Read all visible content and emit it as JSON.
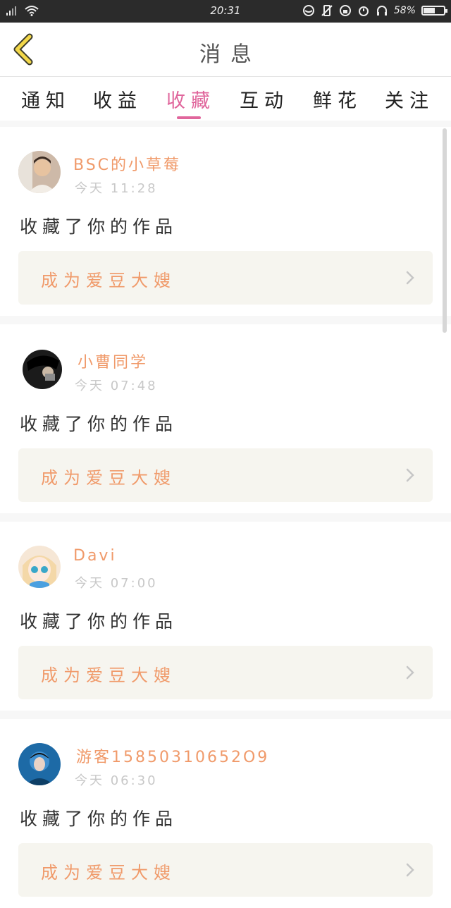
{
  "status_bar": {
    "time": "20:31",
    "battery": "58%",
    "battery_level": 0.58
  },
  "header": {
    "title": "消息"
  },
  "tabs": [
    {
      "label": "通知",
      "active": false
    },
    {
      "label": "收益",
      "active": false
    },
    {
      "label": "收藏",
      "active": true
    },
    {
      "label": "互动",
      "active": false
    },
    {
      "label": "鲜花",
      "active": false
    },
    {
      "label": "关注",
      "active": false
    }
  ],
  "messages": [
    {
      "user": "BSC的小草莓",
      "time": "今天 11:28",
      "text": "收藏了你的作品",
      "action": "成为爱豆大嫂"
    },
    {
      "user": "小曹同学",
      "time": "今天 07:48",
      "text": "收藏了你的作品",
      "action": "成为爱豆大嫂"
    },
    {
      "user": "Davi",
      "time": "今天 07:00",
      "text": "收藏了你的作品",
      "action": "成为爱豆大嫂"
    },
    {
      "user": "游客15850310652O9",
      "time": "今天 06:30",
      "text": "收藏了你的作品",
      "action": "成为爱豆大嫂"
    }
  ],
  "colors": {
    "accent": "#e0669c",
    "username": "#f09a6a",
    "action_bg": "#f6f5ef"
  }
}
